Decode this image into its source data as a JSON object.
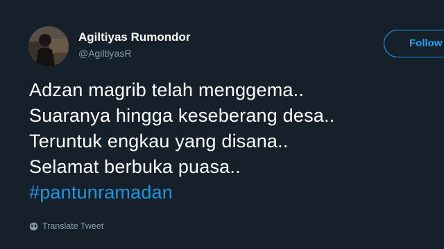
{
  "tweet": {
    "author": {
      "display_name": "Agiltiyas Rumondor",
      "handle": "@AgiltiyasR"
    },
    "follow_label": "Follow",
    "lines": [
      "Adzan magrib telah menggema..",
      "Suaranya hingga keseberang desa..",
      "Teruntuk engkau yang disana..",
      "Selamat berbuka puasa.."
    ],
    "hashtag": "#pantunramadan",
    "translate_label": "Translate Tweet"
  },
  "colors": {
    "background": "#15202b",
    "accent": "#1da1f2",
    "muted": "#8899a6"
  },
  "icons": {
    "translate": "globe-icon"
  }
}
